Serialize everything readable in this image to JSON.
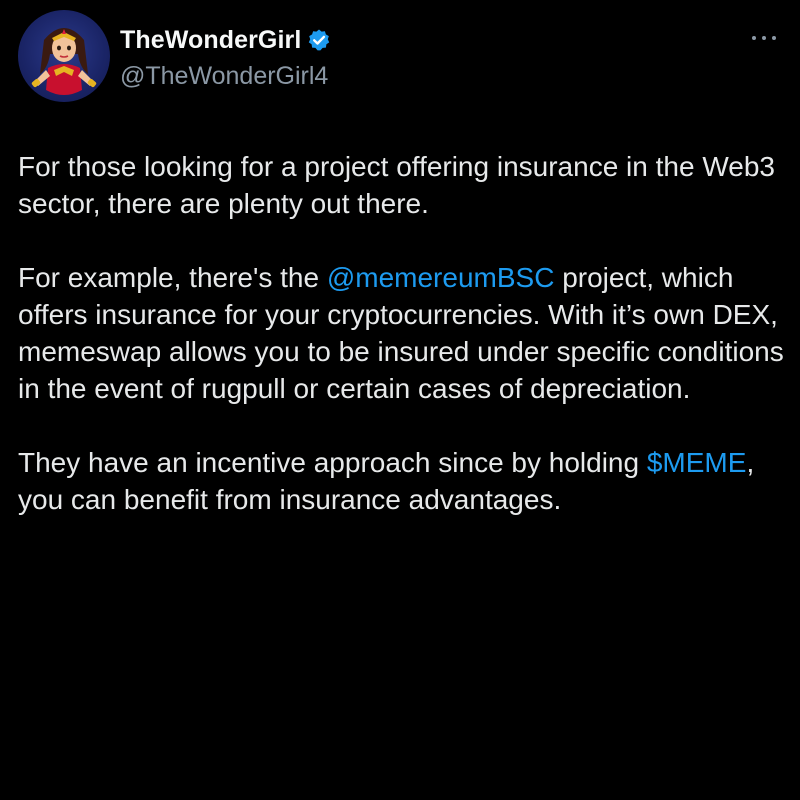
{
  "author": {
    "display_name": "TheWonderGirl",
    "handle": "@TheWonderGirl4",
    "verified": true,
    "avatar": "wonder-girl-avatar"
  },
  "colors": {
    "background": "#000000",
    "text": "#e7e9ea",
    "secondary_text": "#8b98a5",
    "link": "#1d9bf0",
    "verified_badge": "#1d9bf0"
  },
  "icons": {
    "more": "more-options-icon",
    "verified": "verified-badge-icon"
  },
  "post": {
    "p1": "For those looking for a project offering insurance in the Web3 sector, there are plenty out there.",
    "p2_before": "For example, there's the ",
    "p2_mention": "@memereumBSC",
    "p2_after": " project, which offers insurance for your cryptocurrencies. With it’s own DEX, memeswap allows you to be insured under specific conditions in the event of rugpull or certain cases of depreciation.",
    "p3_before": "They have an incentive approach since by holding ",
    "p3_cashtag": "$MEME",
    "p3_after": ", you can benefit from insurance advantages."
  }
}
